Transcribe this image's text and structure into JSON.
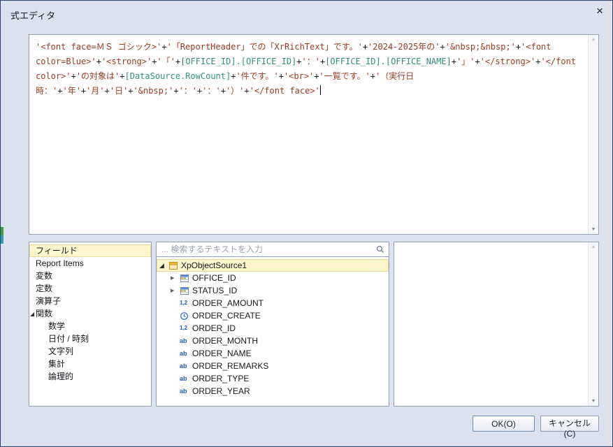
{
  "colors": {
    "dialog_bg": "#dbe2ed",
    "panel_border": "#94a0b4",
    "selection_bg": "#fdf6cc",
    "string_token": "#9a3b1e",
    "field_token": "#2f8f7c",
    "operator_token": "#1c1c1c"
  },
  "dialog": {
    "title": "式エディタ",
    "close_glyph": "×"
  },
  "icons": {
    "expanded_glyph": "◢",
    "collapsed_glyph": "▶",
    "scroll_up_glyph": "▲",
    "scroll_down_glyph": "▼"
  },
  "expression": {
    "tokens": [
      {
        "type": "str",
        "text": "'<font face=ＭＳ ゴシック>'"
      },
      {
        "type": "op",
        "text": "+"
      },
      {
        "type": "str",
        "text": "'「ReportHeader」での「XrRichText」です。'"
      },
      {
        "type": "op",
        "text": "+"
      },
      {
        "type": "str",
        "text": "'2024-2025年の'"
      },
      {
        "type": "op",
        "text": "+"
      },
      {
        "type": "str",
        "text": "'&nbsp;&nbsp;'"
      },
      {
        "type": "op",
        "text": "+"
      },
      {
        "type": "str",
        "text": "'<font color=Blue>'"
      },
      {
        "type": "op",
        "text": "+"
      },
      {
        "type": "str",
        "text": "'<strong>'"
      },
      {
        "type": "op",
        "text": "+"
      },
      {
        "type": "str",
        "text": "'「'"
      },
      {
        "type": "op",
        "text": "+"
      },
      {
        "type": "fld",
        "text": "[OFFICE_ID].[OFFICE_ID]"
      },
      {
        "type": "op",
        "text": "+"
      },
      {
        "type": "str",
        "text": "'：'"
      },
      {
        "type": "op",
        "text": "+"
      },
      {
        "type": "fld",
        "text": "[OFFICE_ID].[OFFICE_NAME]"
      },
      {
        "type": "op",
        "text": "+"
      },
      {
        "type": "str",
        "text": "'」'"
      },
      {
        "type": "op",
        "text": "+"
      },
      {
        "type": "str",
        "text": "'</strong>'"
      },
      {
        "type": "op",
        "text": "+"
      },
      {
        "type": "str",
        "text": "'</font color>'"
      },
      {
        "type": "op",
        "text": "+"
      },
      {
        "type": "str",
        "text": "'の対象は'"
      },
      {
        "type": "op",
        "text": "+"
      },
      {
        "type": "fld",
        "text": "[DataSource.RowCount]"
      },
      {
        "type": "op",
        "text": "+"
      },
      {
        "type": "str",
        "text": "'件です。'"
      },
      {
        "type": "op",
        "text": "+"
      },
      {
        "type": "str",
        "text": "'<br>'"
      },
      {
        "type": "op",
        "text": "+"
      },
      {
        "type": "str",
        "text": "'一覧です。'"
      },
      {
        "type": "op",
        "text": "+"
      },
      {
        "type": "str",
        "text": "'（実行日時：'"
      },
      {
        "type": "op",
        "text": "+"
      },
      {
        "type": "str",
        "text": "'年'"
      },
      {
        "type": "op",
        "text": "+"
      },
      {
        "type": "str",
        "text": "'月'"
      },
      {
        "type": "op",
        "text": "+"
      },
      {
        "type": "str",
        "text": "'日'"
      },
      {
        "type": "op",
        "text": "+"
      },
      {
        "type": "str",
        "text": "'&nbsp;'"
      },
      {
        "type": "op",
        "text": "+"
      },
      {
        "type": "str",
        "text": "'：'"
      },
      {
        "type": "op",
        "text": "+"
      },
      {
        "type": "str",
        "text": "'：'"
      },
      {
        "type": "op",
        "text": "+"
      },
      {
        "type": "str",
        "text": "'）'"
      },
      {
        "type": "op",
        "text": "+"
      },
      {
        "type": "str",
        "text": "'</font face>'"
      }
    ]
  },
  "categories": {
    "items": [
      {
        "label": "フィールド",
        "selected": true
      },
      {
        "label": "Report Items"
      },
      {
        "label": "変数"
      },
      {
        "label": "定数"
      },
      {
        "label": "演算子"
      },
      {
        "label": "関数",
        "expanded": true
      },
      {
        "label": "数学",
        "indent": 1
      },
      {
        "label": "日付 / 時刻",
        "indent": 1
      },
      {
        "label": "文字列",
        "indent": 1
      },
      {
        "label": "集計",
        "indent": 1
      },
      {
        "label": "論理的",
        "indent": 1
      }
    ]
  },
  "search": {
    "placeholder": "... 検索するテキストを入力",
    "value": ""
  },
  "tree": {
    "items": [
      {
        "label": "XpObjectSource1",
        "icon": "datasource-icon",
        "level": 0,
        "expanded": true,
        "selected": true
      },
      {
        "label": "OFFICE_ID",
        "icon": "table-icon",
        "level": 1,
        "expandable": true
      },
      {
        "label": "STATUS_ID",
        "icon": "table-icon",
        "level": 1,
        "expandable": true
      },
      {
        "label": "ORDER_AMOUNT",
        "icon": "number-icon",
        "level": 1
      },
      {
        "label": "ORDER_CREATE",
        "icon": "clock-icon",
        "level": 1
      },
      {
        "label": "ORDER_ID",
        "icon": "number-icon",
        "level": 1
      },
      {
        "label": "ORDER_MONTH",
        "icon": "text-icon",
        "level": 1
      },
      {
        "label": "ORDER_NAME",
        "icon": "text-icon",
        "level": 1
      },
      {
        "label": "ORDER_REMARKS",
        "icon": "text-icon",
        "level": 1
      },
      {
        "label": "ORDER_TYPE",
        "icon": "text-icon",
        "level": 1
      },
      {
        "label": "ORDER_YEAR",
        "icon": "text-icon",
        "level": 1
      }
    ]
  },
  "buttons": {
    "ok": "OK(O)",
    "cancel": "キャンセル(C)"
  }
}
